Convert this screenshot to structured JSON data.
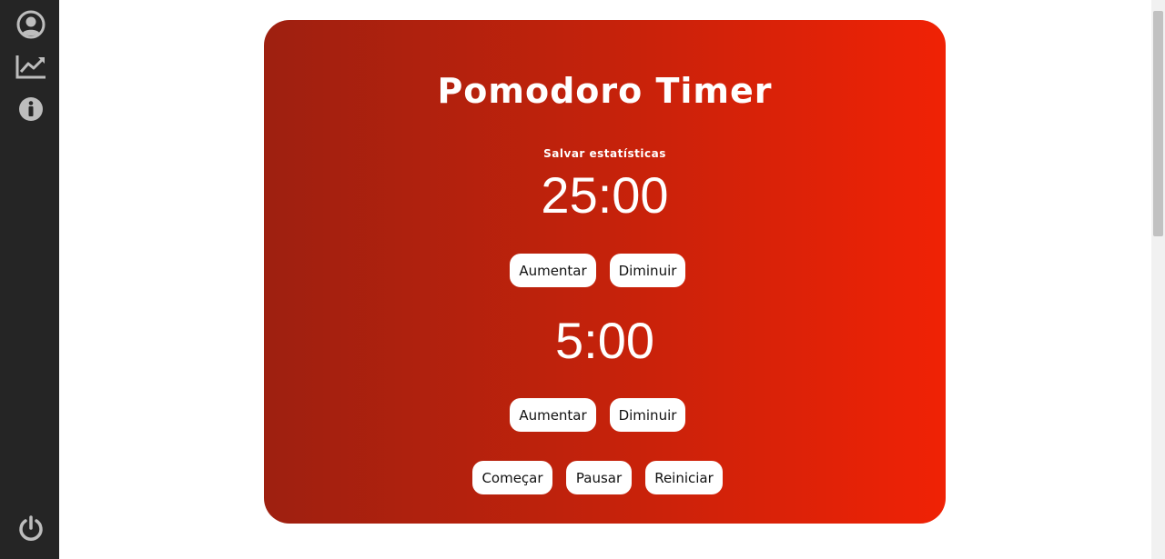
{
  "sidebar": {
    "icons": [
      {
        "name": "user-icon"
      },
      {
        "name": "chart-line-icon"
      },
      {
        "name": "info-icon"
      },
      {
        "name": "power-icon"
      }
    ]
  },
  "card": {
    "title": "Pomodoro Timer",
    "save_label": "Salvar estatísticas",
    "work_timer": "25:00",
    "work_increase": "Aumentar",
    "work_decrease": "Diminuir",
    "break_timer": "5:00",
    "break_increase": "Aumentar",
    "break_decrease": "Diminuir",
    "start": "Começar",
    "pause": "Pausar",
    "reset": "Reiniciar"
  },
  "colors": {
    "sidebar": "#252525",
    "gradient_start": "#9e2010",
    "gradient_end": "#f02205",
    "button_bg": "#ffffff"
  }
}
